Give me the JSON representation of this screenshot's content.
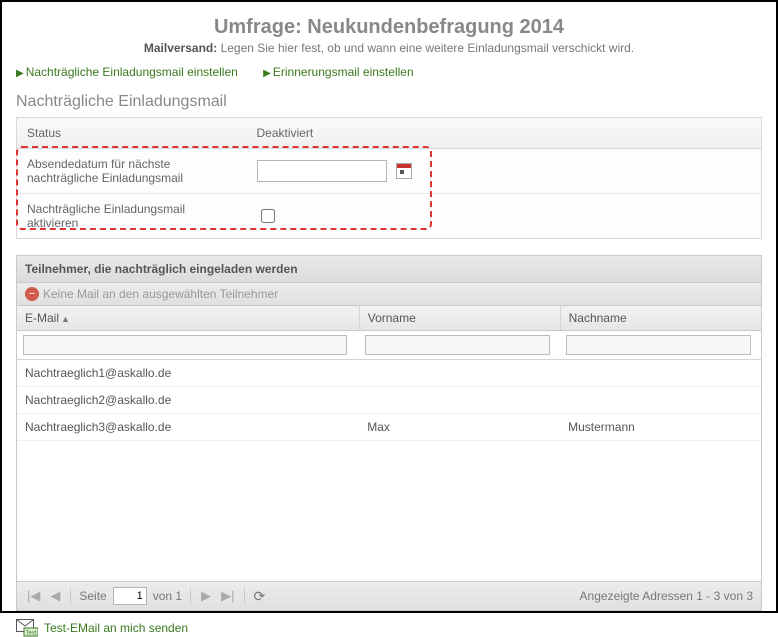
{
  "header": {
    "title": "Umfrage: Neukundenbefragung 2014",
    "subtitle_bold": "Mailversand:",
    "subtitle_text": "Legen Sie hier fest, ob und wann eine weitere Einladungsmail verschickt wird."
  },
  "nav": {
    "link_followup": "Nachträgliche Einladungsmail einstellen",
    "link_reminder": "Erinnerungsmail einstellen"
  },
  "section": {
    "heading": "Nachträgliche Einladungsmail",
    "col_status": "Status",
    "col_value": "Deaktiviert",
    "row_date_label": "Absendedatum für nächste nachträgliche Einladungsmail",
    "row_activate_label": "Nachträgliche Einladungsmail aktivieren",
    "date_value": "",
    "activate_checked": false
  },
  "grid": {
    "title": "Teilnehmer, die nachträglich eingeladen werden",
    "toolbar_action": "Keine Mail an den ausgewählten Teilnehmer",
    "columns": {
      "email": "E-Mail",
      "firstname": "Vorname",
      "lastname": "Nachname"
    },
    "rows": [
      {
        "email": "Nachtraeglich1@askallo.de",
        "firstname": "",
        "lastname": ""
      },
      {
        "email": "Nachtraeglich2@askallo.de",
        "firstname": "",
        "lastname": ""
      },
      {
        "email": "Nachtraeglich3@askallo.de",
        "firstname": "Max",
        "lastname": "Mustermann"
      }
    ],
    "pager": {
      "label_page": "Seite",
      "page": "1",
      "label_of": "von 1",
      "display": "Angezeigte Adressen 1 - 3 von 3"
    }
  },
  "footer": {
    "test_mail": "Test-EMail an mich senden"
  }
}
